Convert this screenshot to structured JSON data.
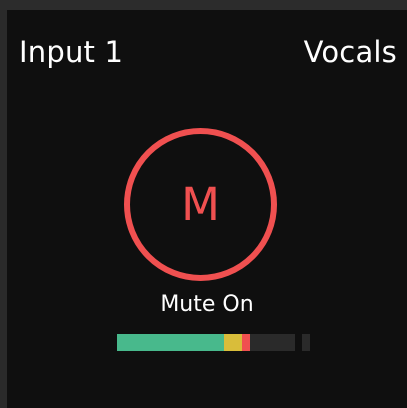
{
  "channel": {
    "input_label": "Input 1",
    "name": "Vocals"
  },
  "mute": {
    "button_letter": "M",
    "status_text": "Mute On",
    "active": true,
    "color": "#f05050"
  },
  "meter": {
    "level_fraction": 0.75,
    "segments": [
      {
        "name": "green",
        "color": "#48b98c",
        "fraction": 0.6
      },
      {
        "name": "yellow",
        "color": "#d9bd3a",
        "fraction": 0.1
      },
      {
        "name": "red",
        "color": "#f05050",
        "fraction": 0.05
      }
    ],
    "track_color": "#2a2a2a"
  },
  "colors": {
    "background": "#0f0f0f",
    "text": "#ffffff"
  }
}
